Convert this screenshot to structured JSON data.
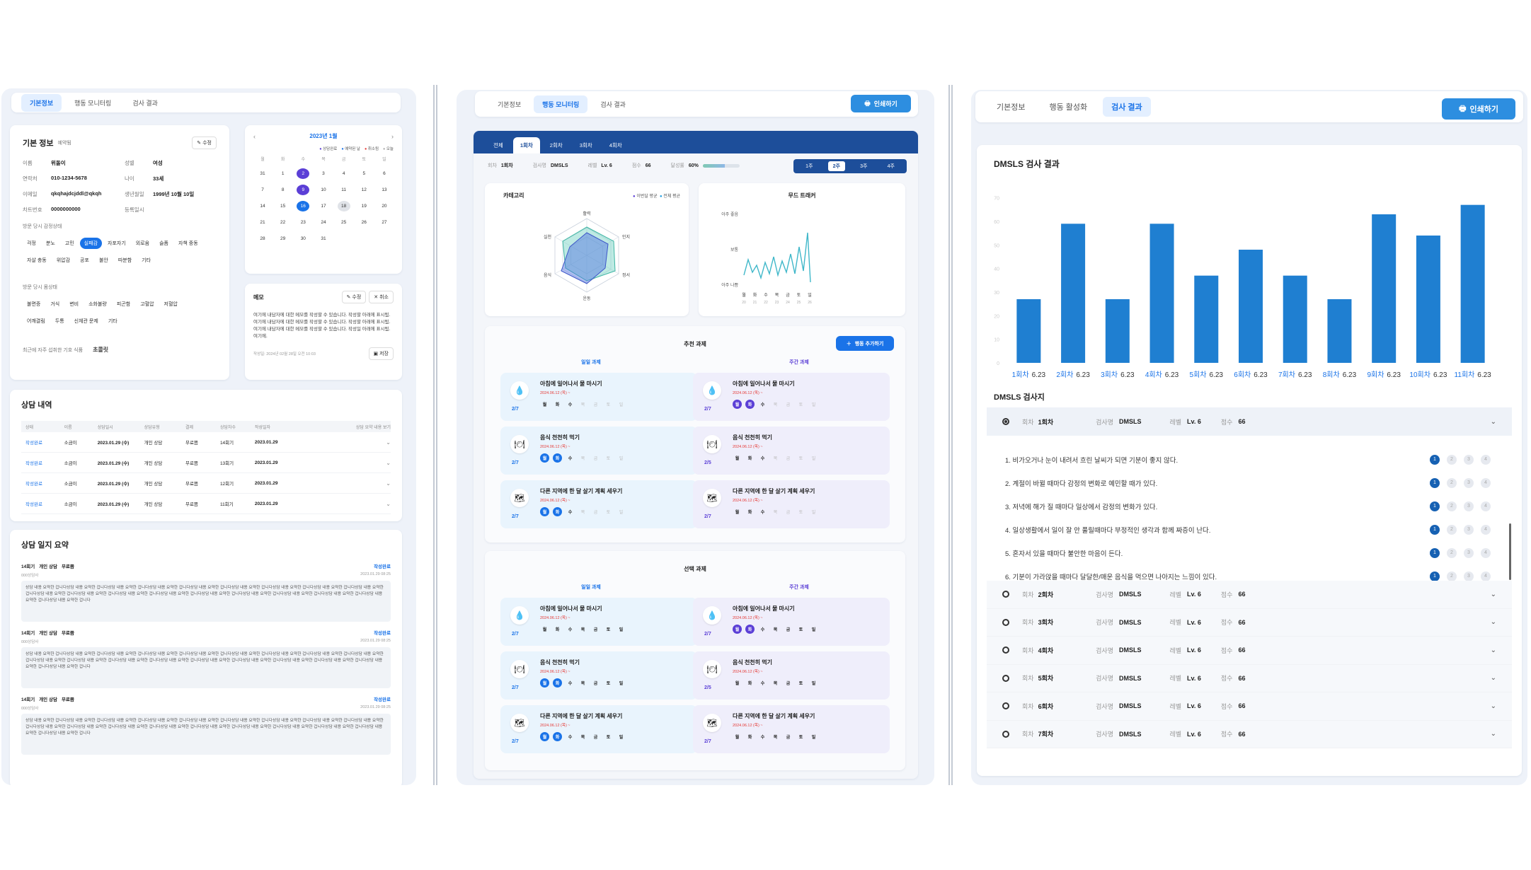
{
  "left": {
    "tabs": [
      "기본정보",
      "행동 모니터링",
      "검사 결과"
    ],
    "basic": {
      "title": "기본 정보",
      "badge": "예약됨",
      "edit": "수정",
      "rows": [
        [
          "이름",
          "위돌이",
          "성별",
          "여성"
        ],
        [
          "연락처",
          "010-1234-5678",
          "나이",
          "33세"
        ],
        [
          "이메일",
          "qkqhajdcjddl@qkqh",
          "생년월일",
          "1999년 10월 10일"
        ],
        [
          "차트번호",
          "0000000000",
          "등록일시",
          ""
        ]
      ],
      "emo_label": "방문 당시 감정상태",
      "emotions": [
        "걱정",
        "분노",
        "고민",
        "실패감",
        "자포자기",
        "외로움",
        "슬픔",
        "자책 중동",
        "자살 충동",
        "위압감",
        "공포",
        "불안",
        "따분함",
        "기타"
      ],
      "symptom_label": "방문 당시 몸상태",
      "symptoms": [
        "불면증",
        "거식",
        "변비",
        "소화불량",
        "피곤함",
        "고혈압",
        "저혈압",
        "어깨결림",
        "두통",
        "신체관 문제",
        "기타"
      ],
      "food_label": "최근에 자주 섭취한 기호 식품",
      "food": "초콜릿"
    },
    "calendar": {
      "title": "2023년 1월",
      "legend": [
        "상담완료",
        "예약된 날",
        "취소됨",
        "오늘"
      ],
      "weekdays": [
        "월",
        "화",
        "수",
        "목",
        "금",
        "토",
        "일"
      ],
      "weeks": [
        [
          "31",
          "1",
          "2",
          "3",
          "4",
          "5",
          "6"
        ],
        [
          "7",
          "8",
          "9",
          "10",
          "11",
          "12",
          "13"
        ],
        [
          "14",
          "15",
          "16",
          "17",
          "18",
          "19",
          "20"
        ],
        [
          "21",
          "22",
          "23",
          "24",
          "25",
          "26",
          "27"
        ],
        [
          "28",
          "29",
          "30",
          "31",
          "",
          "",
          ""
        ]
      ]
    },
    "memo": {
      "title": "메모",
      "edit": "수정",
      "cancel": "취소",
      "text": "여기에 내담자에 대한 메모를 작성할 수 있습니다. 작성할 아래에 표시됨. 여기에 내담자에 대한 메모를 작성할 수 있습니다. 작성할 아래에 표시됨.여기에 내담자에 대한 메모를 작성할 수 있습니다. 작성일 아래에 표시됨.여기에.",
      "meta": "작성일: 2024년 02월 28일 오전 10:03",
      "save": "저장"
    },
    "history": {
      "title": "상담 내역",
      "headers": [
        "상태",
        "이름",
        "상담일시",
        "상담유형",
        "결제",
        "상담차수",
        "작성일자",
        "상담 요약 내용 보기"
      ],
      "rows": [
        [
          "작성완료",
          "소금이",
          "2023.01.29 (수)",
          "개인 상담",
          "무료쯤",
          "14회기",
          "2023.01.29"
        ],
        [
          "작성완료",
          "소금이",
          "2023.01.29 (수)",
          "개인 상담",
          "무료쯤",
          "13회기",
          "2023.01.29"
        ],
        [
          "작성완료",
          "소금이",
          "2023.01.29 (수)",
          "개인 상담",
          "무료쯤",
          "12회기",
          "2023.01.29"
        ],
        [
          "작성완료",
          "소금이",
          "2023.01.29 (수)",
          "개인 상담",
          "무료쯤",
          "11회기",
          "2023.01.29"
        ]
      ]
    },
    "summary": {
      "title": "상담 일지 요약",
      "items": [
        {
          "tags": [
            "14회기",
            "개인 상담",
            "무료쯤"
          ],
          "status": "작성완료",
          "who": "000상담사",
          "date": "2023.01.29 08:25"
        },
        {
          "tags": [
            "14회기",
            "개인 상담",
            "무료쯤"
          ],
          "status": "작성완료",
          "who": "000상담사",
          "date": "2023.01.29 08:25"
        },
        {
          "tags": [
            "14회기",
            "개인 상담",
            "무료쯤"
          ],
          "status": "작성완료",
          "who": "000상담사",
          "date": "2023.01.29 08:25"
        }
      ],
      "body": "상담 내용 요약한 겁니다상담 내용 요약한 겁니다상담 내용 요약한 겁니다상담 내용 요약한 겁니다상담 내용 요약한 겁니다상담 내용 요약한 겁니다상담 내용 요약한 겁니다상담 내용 요약한 겁니다상담 내용 요약한 겁니다상담 내용 요약한 겁니다상담 내용 요약한 겁니다상담 내용 요약한 겁니다상담 내용 요약한 겁니다상담 내용 요약한 겁니다상담 내용 요약한 겁니다상담 내용 요약한 겁니다상담 내용 요약한 겁니다상담 내용 요약한 겁니다상담 내용 요약한 겁니다"
    }
  },
  "middle": {
    "tabs": [
      "기본정보",
      "행동 모니터링",
      "검사 결과"
    ],
    "print": "인쇄하기",
    "rounds": [
      "전체",
      "1회차",
      "2회차",
      "3회차",
      "4회차"
    ],
    "meta": {
      "round_label": "회차",
      "round": "1회차",
      "test_label": "검사명",
      "test": "DMSLS",
      "level_label": "레벨",
      "level": "Lv. 6",
      "score_label": "점수",
      "score": "66",
      "rate_label": "달성률",
      "rate": "60%",
      "rate_value": 0.6
    },
    "weeks": [
      "1주",
      "2주",
      "3주",
      "4주"
    ],
    "radar": {
      "title": "카테고리",
      "legend": [
        "이번달 평균",
        "전체 평균"
      ],
      "axes": [
        "활력",
        "인지",
        "정서",
        "운동",
        "음식",
        "실천"
      ]
    },
    "mood": {
      "title": "무드 트래커",
      "levels": [
        "아주 좋음",
        "보통",
        "아주 나쁨"
      ],
      "days": [
        "월",
        "화",
        "수",
        "목",
        "금",
        "토",
        "일"
      ],
      "dates": [
        "20",
        "21",
        "22",
        "23",
        "24",
        "25",
        "26"
      ]
    },
    "recommend": {
      "title": "추천 과제",
      "add": "행동 추가하기",
      "daily": "일일 과제",
      "weekly": "주간 과제"
    },
    "choice": {
      "title": "선택 과제",
      "daily": "일일 과제",
      "weekly": "주간 과제"
    },
    "days": [
      "월",
      "화",
      "수",
      "목",
      "금",
      "토",
      "일"
    ],
    "task_names": [
      "아침에 일어나서 물 마시기",
      "음식 천천히 먹기",
      "다른 지역에 한 달 살기 계획 세우기"
    ],
    "task_date": "2024.06.12 (목) ~",
    "counts_left": [
      "2/7",
      "2/7",
      "2/7"
    ],
    "counts_right": [
      "2/7",
      "2/5",
      "2/7"
    ]
  },
  "right": {
    "tabs": [
      "기본정보",
      "행동 활성화",
      "검사 결과"
    ],
    "print": "인쇄하기",
    "chart_title": "DMSLS 검사 결과",
    "chart_data": {
      "type": "bar",
      "categories": [
        "1회차",
        "2회차",
        "3회차",
        "4회차",
        "5회차",
        "6회차",
        "7회차",
        "8회차",
        "9회차",
        "10회차",
        "11회차"
      ],
      "dates": [
        "6.23",
        "6.23",
        "6.23",
        "6.23",
        "6.23",
        "6.23",
        "6.23",
        "6.23",
        "6.23",
        "6.23",
        "6.23"
      ],
      "values": [
        27,
        59,
        27,
        59,
        37,
        48,
        37,
        27,
        63,
        54,
        67
      ],
      "ylim": [
        0,
        75
      ],
      "yticks": [
        "0",
        "10",
        "20",
        "30",
        "40",
        "50",
        "60",
        "70"
      ]
    },
    "sheet_title": "DMSLS 검사지",
    "labels": {
      "round": "회차",
      "test": "검사명",
      "level": "레벨",
      "score": "점수"
    },
    "first": {
      "round": "1회차",
      "test": "DMSLS",
      "level": "Lv. 6",
      "score": "66"
    },
    "questions": [
      "1. 비가오거나 눈이 내려서 흐린 날씨가 되면 기분이 좋지 않다.",
      "2. 계절이 바뀔 때마다 감정의 변화로 예민할 때가 있다.",
      "3. 저녁에 해가 질 때마다 일상에서 감정의 변화가 있다.",
      "4. 일상생활에서 일이 잘 안 풀릴때마다 부정적인 생각과 함께 짜증이 난다.",
      "5. 혼자서 있을 때마다 불안한 마음이 든다.",
      "6. 기분이 가라앉을 때마다 달달한/매운 음식을 먹으면 나아지는 느낌이 있다."
    ],
    "options": [
      "1",
      "2",
      "3",
      "4"
    ],
    "others": [
      {
        "round": "2회차",
        "test": "DMSLS",
        "level": "Lv. 6",
        "score": "66"
      },
      {
        "round": "3회차",
        "test": "DMSLS",
        "level": "Lv. 6",
        "score": "66"
      },
      {
        "round": "4회차",
        "test": "DMSLS",
        "level": "Lv. 6",
        "score": "66"
      },
      {
        "round": "5회차",
        "test": "DMSLS",
        "level": "Lv. 6",
        "score": "66"
      },
      {
        "round": "6회차",
        "test": "DMSLS",
        "level": "Lv. 6",
        "score": "66"
      },
      {
        "round": "7회차",
        "test": "DMSLS",
        "level": "Lv. 6",
        "score": "66"
      }
    ]
  }
}
